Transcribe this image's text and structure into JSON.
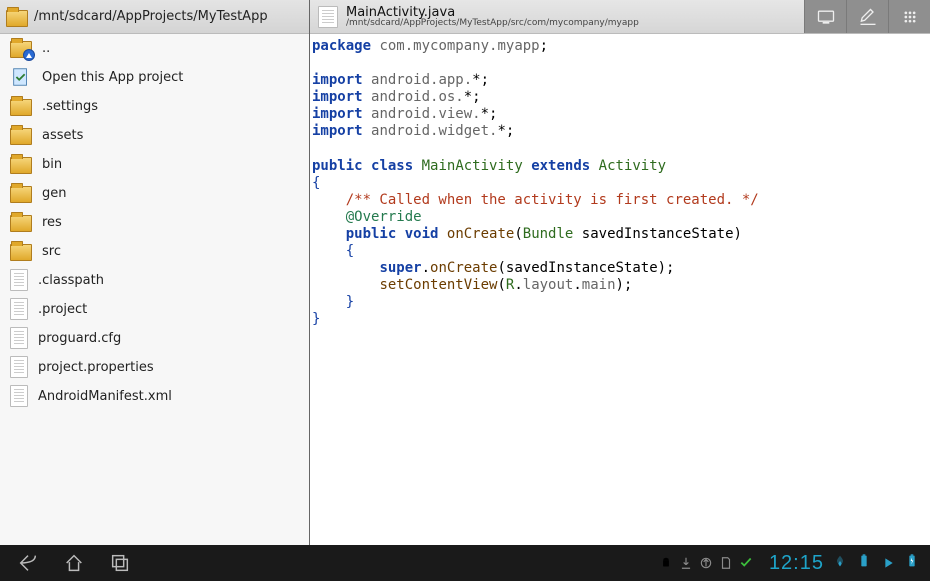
{
  "left": {
    "path": "/mnt/sdcard/AppProjects/MyTestApp",
    "items": [
      {
        "label": "..",
        "kind": "up"
      },
      {
        "label": "Open this App project",
        "kind": "open"
      },
      {
        "label": ".settings",
        "kind": "folder"
      },
      {
        "label": "assets",
        "kind": "folder"
      },
      {
        "label": "bin",
        "kind": "folder"
      },
      {
        "label": "gen",
        "kind": "folder"
      },
      {
        "label": "res",
        "kind": "folder"
      },
      {
        "label": "src",
        "kind": "folder"
      },
      {
        "label": ".classpath",
        "kind": "file"
      },
      {
        "label": ".project",
        "kind": "file"
      },
      {
        "label": "proguard.cfg",
        "kind": "file"
      },
      {
        "label": "project.properties",
        "kind": "file"
      },
      {
        "label": "AndroidManifest.xml",
        "kind": "file"
      }
    ]
  },
  "right": {
    "tab": {
      "filename": "MainActivity.java",
      "filepath": "/mnt/sdcard/AppProjects/MyTestApp/src/com/mycompany/myapp"
    },
    "code": {
      "pkg_kw": "package",
      "pkg_path": "com.mycompany.myapp",
      "imp_kw": "import",
      "imp1": "android.app.",
      "imp2": "android.os.",
      "imp3": "android.view.",
      "imp4": "android.widget.",
      "star": "*",
      "public": "public",
      "class": "class",
      "extends": "extends",
      "void": "void",
      "cls_main": "MainActivity",
      "cls_act": "Activity",
      "cls_bundle": "Bundle",
      "cmt": "/** Called when the activity is first created. */",
      "ann": "@Override",
      "m_onCreate": "onCreate",
      "p_saved": "savedInstanceState",
      "m_super": "super",
      "m_onCreate2": "onCreate",
      "arg_saved": "savedInstanceState",
      "m_scv": "setContentView",
      "r": "R",
      "layout": "layout",
      "main": "main"
    }
  },
  "sysbar": {
    "time": "12:15"
  }
}
